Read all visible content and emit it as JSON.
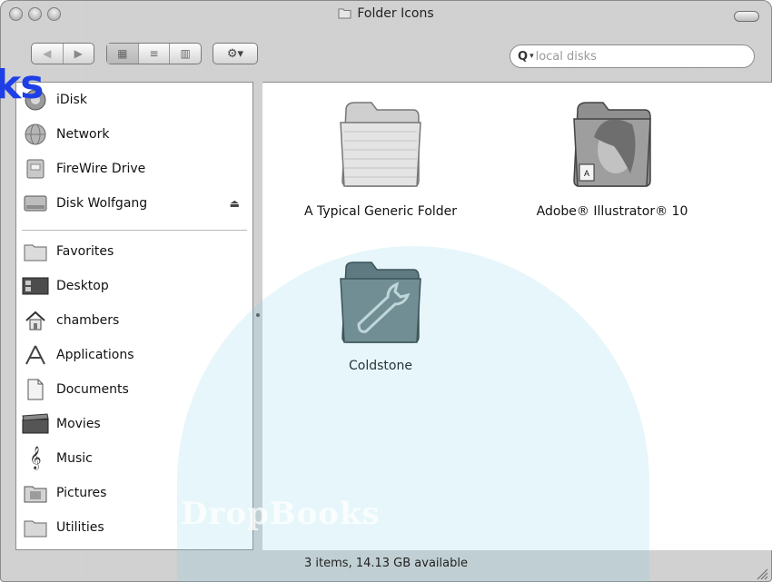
{
  "window": {
    "title": "Folder Icons"
  },
  "toolbar": {
    "back_label": "◀",
    "forward_label": "▶",
    "view_icon_label": "▦",
    "view_list_label": "≡",
    "view_column_label": "▥",
    "action_label": "⚙▾"
  },
  "search": {
    "value": "local disks"
  },
  "sidebar": {
    "devices": [
      {
        "label": "iDisk",
        "icon": "idisk-icon"
      },
      {
        "label": "Network",
        "icon": "network-icon"
      },
      {
        "label": "FireWire Drive",
        "icon": "firewire-drive-icon"
      },
      {
        "label": "Disk Wolfgang",
        "icon": "hard-disk-icon",
        "eject": "⏏"
      }
    ],
    "places": [
      {
        "label": "Favorites",
        "icon": "favorites-folder-icon"
      },
      {
        "label": "Desktop",
        "icon": "desktop-icon"
      },
      {
        "label": "chambers",
        "icon": "home-icon"
      },
      {
        "label": "Applications",
        "icon": "applications-icon"
      },
      {
        "label": "Documents",
        "icon": "documents-icon"
      },
      {
        "label": "Movies",
        "icon": "movies-icon"
      },
      {
        "label": "Music",
        "icon": "music-icon"
      },
      {
        "label": "Pictures",
        "icon": "pictures-icon"
      },
      {
        "label": "Utilities",
        "icon": "utilities-folder-icon"
      }
    ]
  },
  "content": {
    "items": [
      {
        "label": "A Typical Generic Folder",
        "icon": "generic-folder-icon"
      },
      {
        "label": "Adobe® Illustrator® 10",
        "icon": "illustrator-folder-icon"
      },
      {
        "label": "Coldstone",
        "icon": "wrench-folder-icon"
      }
    ]
  },
  "status": {
    "text": "3 items, 14.13 GB available"
  },
  "watermark": {
    "corner_text": "ks",
    "center_text": "DropBooks"
  }
}
